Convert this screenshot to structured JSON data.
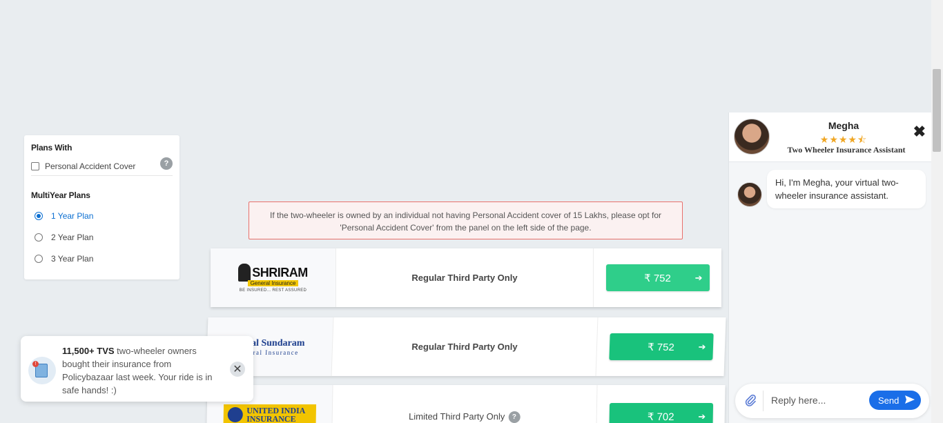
{
  "filters": {
    "plans_with_heading": "Plans With",
    "personal_accident_label": "Personal Accident Cover",
    "help_symbol": "?",
    "multiyear_heading": "MultiYear Plans",
    "year_plans": [
      {
        "label": "1 Year Plan",
        "selected": true
      },
      {
        "label": "2 Year Plan",
        "selected": false
      },
      {
        "label": "3 Year Plan",
        "selected": false
      }
    ]
  },
  "warning": {
    "line1": "If the two-wheeler is owned by an individual not having Personal Accident cover of 15 Lakhs, please opt for",
    "line2": "'Personal Accident Cover' from the panel on the left side of the page."
  },
  "plans": [
    {
      "insurer_word": "SHRIRAM",
      "insurer_sub": "General Insurance",
      "insurer_tag": "BE INSURED... REST ASSURED",
      "description": "Regular Third Party Only",
      "price": "₹ 752"
    },
    {
      "insurer_word": "Royal Sundaram",
      "insurer_sub": "General Insurance",
      "description": "Regular Third Party Only",
      "price": "₹ 752"
    },
    {
      "insurer_word": "UNITED INDIA",
      "insurer_sub": "INSURANCE",
      "description": "Limited Third Party Only",
      "price": "₹ 702"
    }
  ],
  "toast": {
    "count": "11,500+ TVS",
    "text": " two-wheeler owners bought their insurance from Policybazaar last week. Your ride is in safe hands! :)",
    "badge": "!",
    "close_symbol": "✕"
  },
  "chat": {
    "agent_name": "Megha",
    "stars": "★★★★⯪",
    "agent_role": "Two Wheeler Insurance Assistant",
    "close_symbol": "✖",
    "message": "Hi, I'm Megha, your virtual two-wheeler insurance assistant.",
    "reply_placeholder": "Reply here...",
    "send_label": "Send"
  },
  "colors": {
    "accent": "#19c27c",
    "send": "#1a6ee8",
    "warning_border": "#e8706b",
    "star": "#f0a623"
  }
}
